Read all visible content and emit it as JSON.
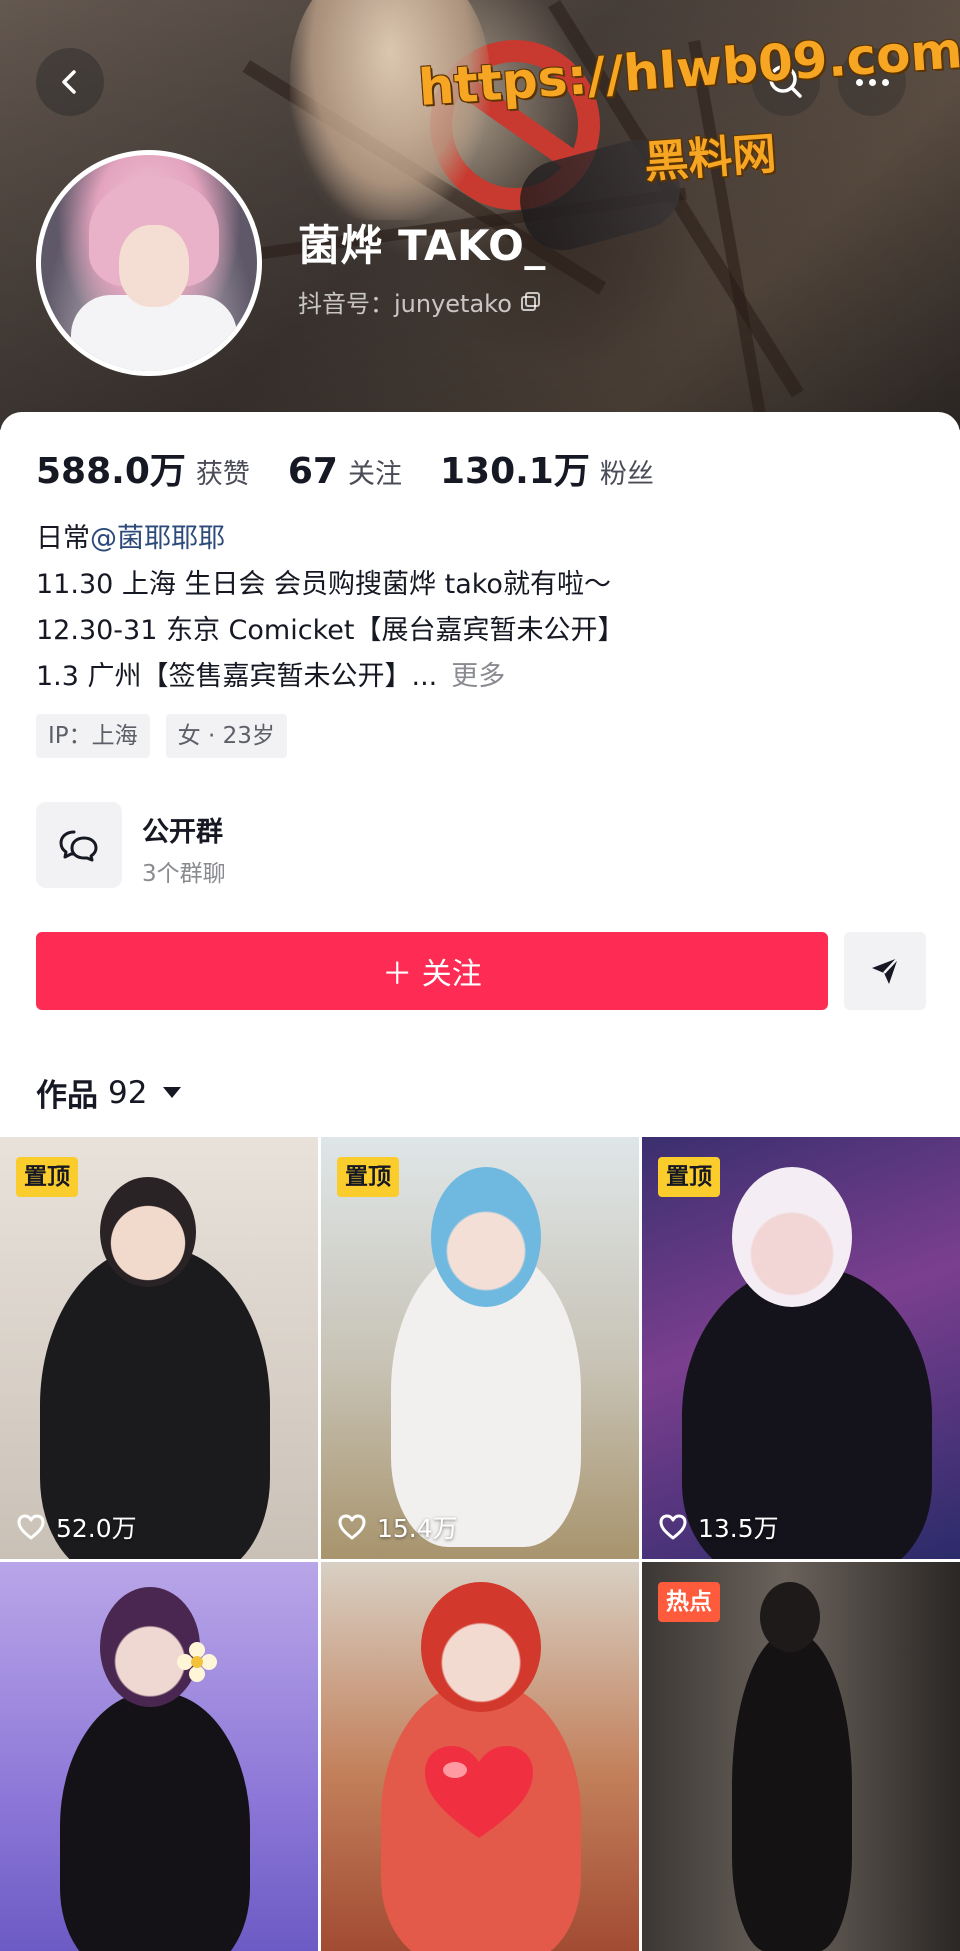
{
  "header": {
    "nickname": "菌烨 TAKO_",
    "douyin_id": "抖音号：junyetako",
    "watermark_url": "https://hlwb09.com",
    "watermark_name": "黑料网"
  },
  "stats": [
    {
      "value": "588.0万",
      "label": "获赞"
    },
    {
      "value": "67",
      "label": "关注"
    },
    {
      "value": "130.1万",
      "label": "粉丝"
    }
  ],
  "bio": {
    "line1_prefix": "日常",
    "line1_mention": "@菌耶耶耶",
    "line2": "11.30 上海 生日会 会员购搜菌烨 tako就有啦～",
    "line3": "12.30-31 东京 Comicket【展台嘉宾暂未公开】",
    "line4": "1.3 广州【签售嘉宾暂未公开】...",
    "more": "更多"
  },
  "tags": [
    "IP：上海",
    "女 · 23岁"
  ],
  "group": {
    "title": "公开群",
    "subtitle": "3个群聊"
  },
  "actions": {
    "follow_label": "＋ 关注"
  },
  "works": {
    "label": "作品",
    "count": "92"
  },
  "videos": [
    {
      "badge": "置顶",
      "likes": "52.0万"
    },
    {
      "badge": "置顶",
      "likes": "15.4万"
    },
    {
      "badge": "置顶",
      "likes": "13.5万"
    },
    {
      "badge": "",
      "likes": ""
    },
    {
      "badge": "",
      "likes": ""
    },
    {
      "badge": "热点",
      "likes": ""
    }
  ],
  "colors": {
    "follow": "#fe2c55",
    "pin_badge": "#facd2d",
    "hot_badge": "#fe5a3c",
    "mention": "#2c4a7a"
  }
}
